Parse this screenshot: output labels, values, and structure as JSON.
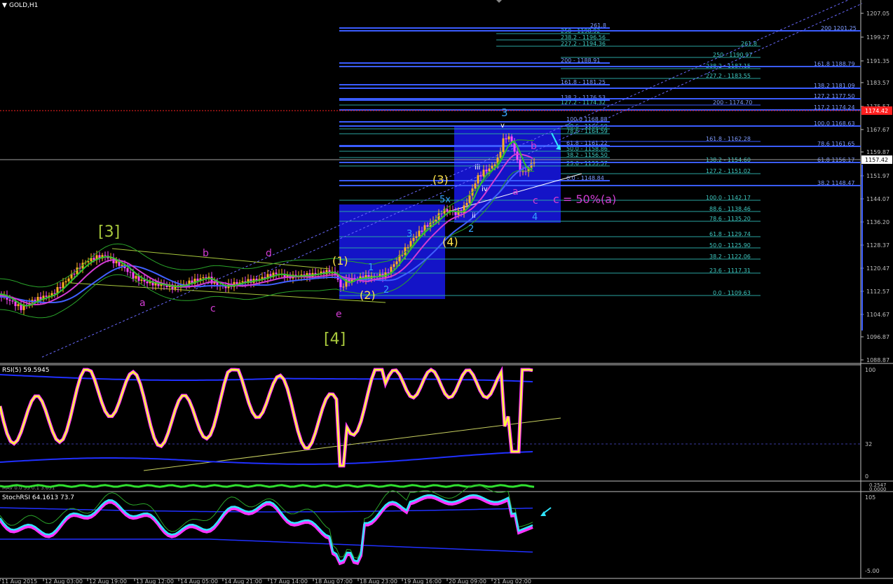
{
  "window": {
    "title": "GOLD,H1",
    "rsi_label": "RSI(5) 59.5945",
    "stoch_label": "StochRSI 64.1613 73.7",
    "mid_label": "MAV 0.0 55 0.1 3.651"
  },
  "colors": {
    "bg": "#000000",
    "axis": "#c0c0c0",
    "grid_line": "#ffffff",
    "fib_blue": "#3a5cff",
    "fib_teal": "#2aa5a0",
    "box_blue": "#1a1aff",
    "wave_magenta": "#d23cd2",
    "wave_yellow": "#ffe34a",
    "wave_green": "#a8c83c",
    "wave_cyan": "#35a5ff",
    "price_red": "#ff2020",
    "rsi_yellow": "#ffff3a",
    "rsi_magenta": "#ff35ff",
    "stoch_cyan": "#30e6ff"
  },
  "price_axis": [
    {
      "value": "1207.05"
    },
    {
      "value": "1199.27"
    },
    {
      "value": "1191.35"
    },
    {
      "value": "1183.57"
    },
    {
      "value": "1175.57"
    },
    {
      "value": "1167.67"
    },
    {
      "value": "1159.87"
    },
    {
      "value": "1151.97"
    },
    {
      "value": "1144.07"
    },
    {
      "value": "1136.20"
    },
    {
      "value": "1128.37"
    },
    {
      "value": "1120.47"
    },
    {
      "value": "1112.57"
    },
    {
      "value": "1104.67"
    },
    {
      "value": "1096.87"
    },
    {
      "value": "1088.87"
    }
  ],
  "current_price": "1157.42",
  "red_price": "1174.42",
  "rsi_axis": [
    "100",
    "32",
    "0"
  ],
  "mid_axis": [
    "0.2547",
    "0.0000"
  ],
  "stoch_axis": [
    "105",
    "-5.00"
  ],
  "time_axis": [
    "11 Aug 2015",
    "12 Aug 03:00",
    "12 Aug 19:00",
    "13 Aug 12:00",
    "14 Aug 05:00",
    "14 Aug 21:00",
    "17 Aug 14:00",
    "18 Aug 07:00",
    "18 Aug 23:00",
    "19 Aug 16:00",
    "20 Aug 09:00",
    "21 Aug 02:00"
  ],
  "fib_labels_left": [
    {
      "text": "261.8"
    },
    {
      "text": "250 - 1198.92"
    },
    {
      "text": "238.2 - 1196.56"
    },
    {
      "text": "227.2 - 1194.36"
    },
    {
      "text": "200 - 1188.91"
    },
    {
      "text": "161.8 - 1181.25"
    },
    {
      "text": "138.2 - 1176.53"
    },
    {
      "text": "127.2 - 1174.32"
    },
    {
      "text": "100.0 1168.88"
    },
    {
      "text": "88.6 - 1166.59"
    },
    {
      "text": "78.6 - 1164.59"
    },
    {
      "text": "61.8 - 1161.22"
    },
    {
      "text": "50.0 - 1158.86"
    },
    {
      "text": "38.2 - 1156.50"
    },
    {
      "text": "23.6 - 1153.57"
    },
    {
      "text": "0.0 - 1148.84"
    }
  ],
  "fib_labels_mid": [
    {
      "text": "261.8"
    },
    {
      "text": "250 - 1190.97"
    },
    {
      "text": "238.2 - 1187.15"
    },
    {
      "text": "227.2 - 1183.55"
    },
    {
      "text": "200 - 1174.70"
    },
    {
      "text": "161.8 - 1162.28"
    },
    {
      "text": "138.2 - 1154.60"
    },
    {
      "text": "127.2 - 1151.02"
    },
    {
      "text": "100.0 - 1142.17"
    },
    {
      "text": "88.6 - 1138.46"
    },
    {
      "text": "78.6 - 1135.20"
    },
    {
      "text": "61.8 - 1129.74"
    },
    {
      "text": "50.0 - 1125.90"
    },
    {
      "text": "38.2 - 1122.06"
    },
    {
      "text": "23.6 - 1117.31"
    },
    {
      "text": "0.0 - 1109.63"
    }
  ],
  "fib_labels_right": [
    {
      "text": "200 1201.25"
    },
    {
      "text": "161.8 1188.79"
    },
    {
      "text": "138.2 1181.09"
    },
    {
      "text": "127.2 1177.50"
    },
    {
      "text": "117.2 1174.24"
    },
    {
      "text": "100.0 1168.63"
    },
    {
      "text": "78.6 1161.65"
    },
    {
      "text": "61.8 1156.17"
    },
    {
      "text": "38.2 1148.47"
    }
  ],
  "waves": {
    "w3_big": "[3]",
    "w4_big": "[4]",
    "a1": "a",
    "b1": "b",
    "c1": "c",
    "d1": "d",
    "e1": "e",
    "p1": "(1)",
    "p2": "(2)",
    "p3": "(3)",
    "p4": "(4)",
    "n1": "1",
    "n2": "2",
    "n3": "3",
    "n4": "4",
    "n3_top": "3",
    "n5x": "5x",
    "i": "i",
    "ii": "ii",
    "iii": "iii",
    "iv": "iv",
    "v": "v",
    "a2": "a",
    "b2": "b",
    "c2": "c",
    "c_eq": "c = 50%(a)",
    "n2b": "2",
    "n4b": "4"
  },
  "chart_data": {
    "type": "candlestick",
    "symbol": "GOLD",
    "timeframe": "H1",
    "ylim": [
      1088.87,
      1210.5
    ],
    "x": [
      "11 Aug 2015",
      "12 Aug 03:00",
      "12 Aug 19:00",
      "13 Aug 12:00",
      "14 Aug 05:00",
      "14 Aug 21:00",
      "17 Aug 14:00",
      "18 Aug 07:00",
      "18 Aug 23:00",
      "19 Aug 16:00",
      "20 Aug 09:00",
      "21 Aug 02:00"
    ],
    "close": [
      1104,
      1110,
      1124,
      1116,
      1114,
      1116,
      1120,
      1117,
      1120,
      1133,
      1146,
      1157.42
    ],
    "last_price": 1157.42
  }
}
